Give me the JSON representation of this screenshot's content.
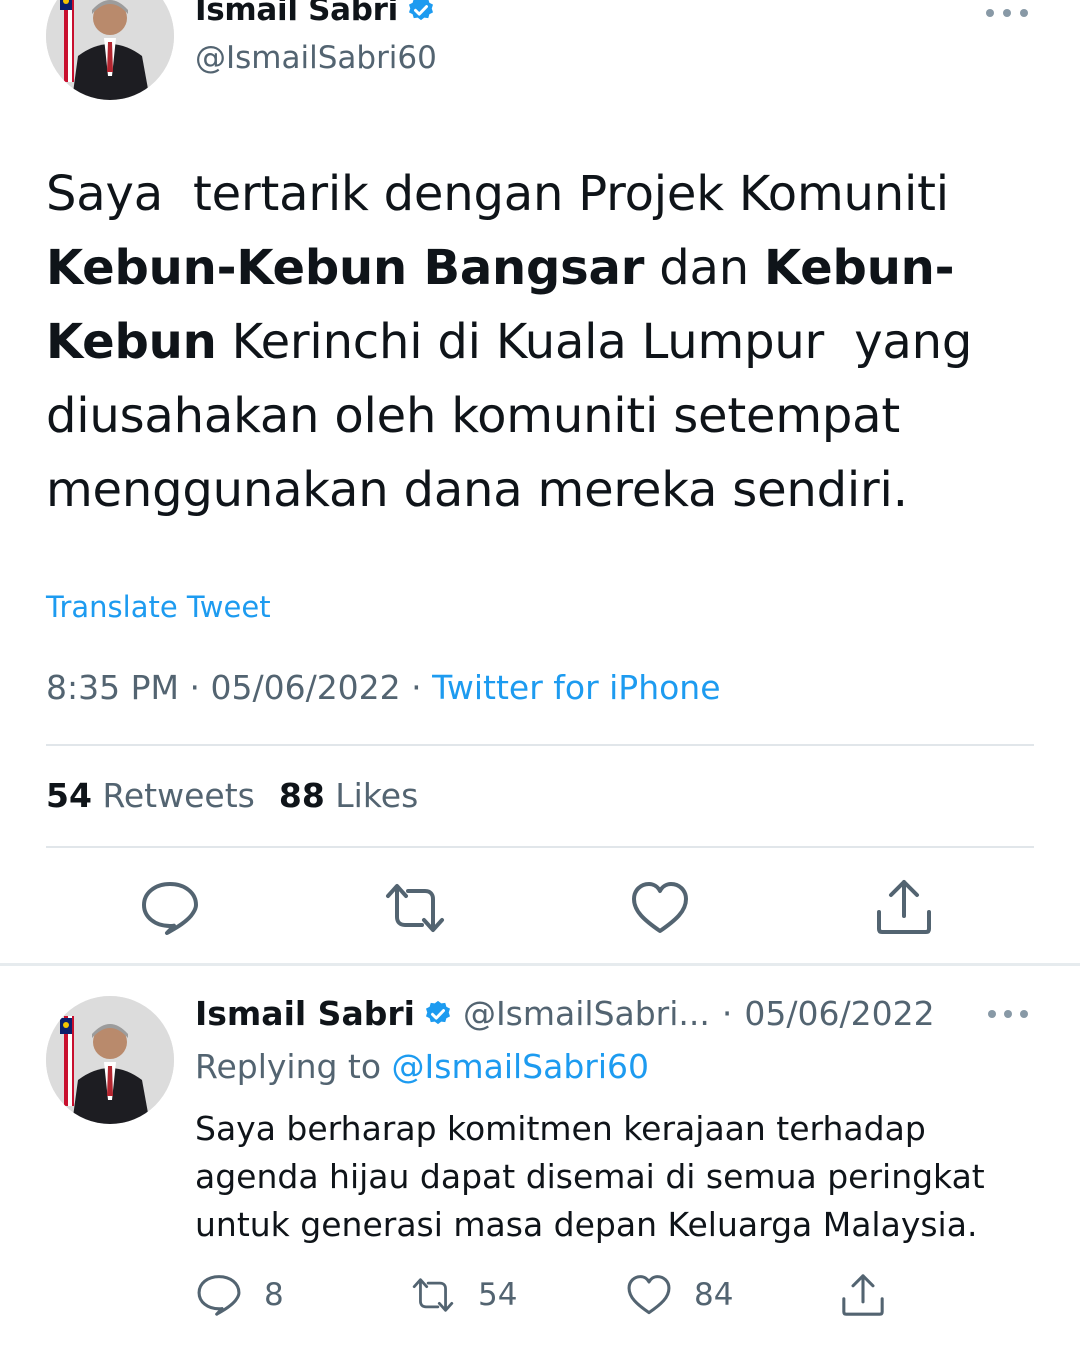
{
  "main_tweet": {
    "author_name": "Ismail Sabri",
    "handle": "@IsmailSabri60",
    "text_lines": [
      [
        {
          "t": "Saya  tertarik dengan Projek Komuniti",
          "b": false
        }
      ],
      [
        {
          "t": "Kebun-Kebun Bangsar",
          "b": true
        },
        {
          "t": " dan ",
          "b": false
        },
        {
          "t": "Kebun-",
          "b": true
        }
      ],
      [
        {
          "t": "Kebun",
          "b": true
        },
        {
          "t": " Kerinchi di Kuala Lumpur  yang",
          "b": false
        }
      ],
      [
        {
          "t": "diusahakan oleh komuniti setempat",
          "b": false
        }
      ],
      [
        {
          "t": "menggunakan dana mereka sendiri.",
          "b": false
        }
      ]
    ],
    "translate_label": "Translate Tweet",
    "time": "8:35 PM",
    "date": "05/06/2022",
    "separator": "·",
    "source": "Twitter for iPhone",
    "retweets_count": "54",
    "retweets_label": "Retweets",
    "likes_count": "88",
    "likes_label": "Likes"
  },
  "reply_tweet": {
    "author_name": "Ismail Sabri",
    "handle": "@IsmailSabri...",
    "separator": "·",
    "date": "05/06/2022",
    "replying_label": "Replying to",
    "replying_to": "@IsmailSabri60",
    "text_lines": [
      "Saya berharap komitmen kerajaan terhadap",
      "agenda hijau dapat disemai di semua peringkat",
      "untuk generasi masa depan Keluarga Malaysia."
    ],
    "reply_count": "8",
    "retweet_count": "54",
    "like_count": "84"
  },
  "icons": {
    "verified": "verified-badge-icon",
    "more": "more-icon",
    "reply": "reply-icon",
    "retweet": "retweet-icon",
    "like": "heart-icon",
    "share": "share-icon"
  },
  "colors": {
    "accent": "#1d9bf0",
    "text": "#0f1419",
    "secondary": "#536471",
    "icon": "#536471",
    "divider": "#e1e6ea"
  }
}
